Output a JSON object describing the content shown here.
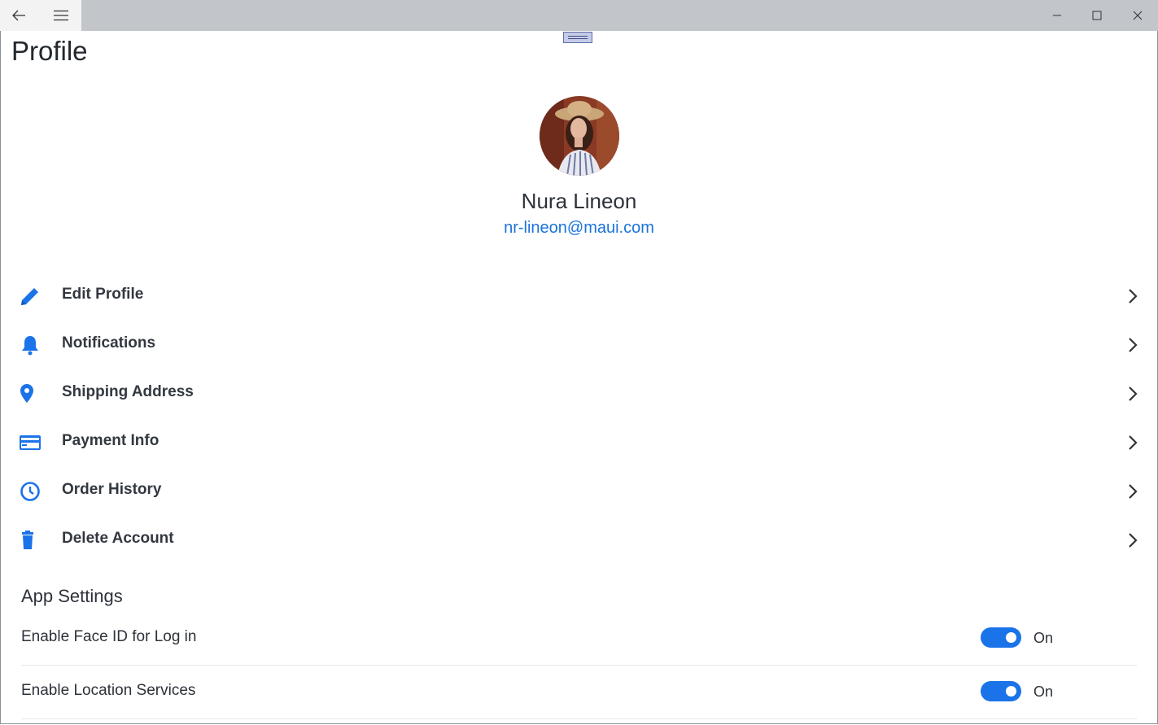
{
  "window": {
    "back_icon": "arrow-left-icon",
    "menu_icon": "hamburger-icon",
    "minimize_icon": "minimize-icon",
    "maximize_icon": "maximize-icon",
    "close_icon": "close-icon"
  },
  "page": {
    "title": "Profile"
  },
  "user": {
    "name": "Nura Lineon",
    "email": "nr-lineon@maui.com",
    "avatar_icon": "user-avatar"
  },
  "colors": {
    "accent": "#1a73e8",
    "link": "#1a73d9",
    "text": "#2d323a",
    "titlebar": "#c2c6cb"
  },
  "menu": [
    {
      "label": "Edit Profile",
      "icon": "pencil-icon"
    },
    {
      "label": "Notifications",
      "icon": "bell-icon"
    },
    {
      "label": "Shipping Address",
      "icon": "map-pin-icon"
    },
    {
      "label": "Payment Info",
      "icon": "credit-card-icon"
    },
    {
      "label": "Order History",
      "icon": "clock-icon"
    },
    {
      "label": "Delete Account",
      "icon": "trash-icon"
    }
  ],
  "app_settings": {
    "title": "App Settings",
    "items": [
      {
        "label": "Enable Face ID for Log in",
        "state": "On"
      },
      {
        "label": "Enable Location Services",
        "state": "On"
      }
    ]
  }
}
